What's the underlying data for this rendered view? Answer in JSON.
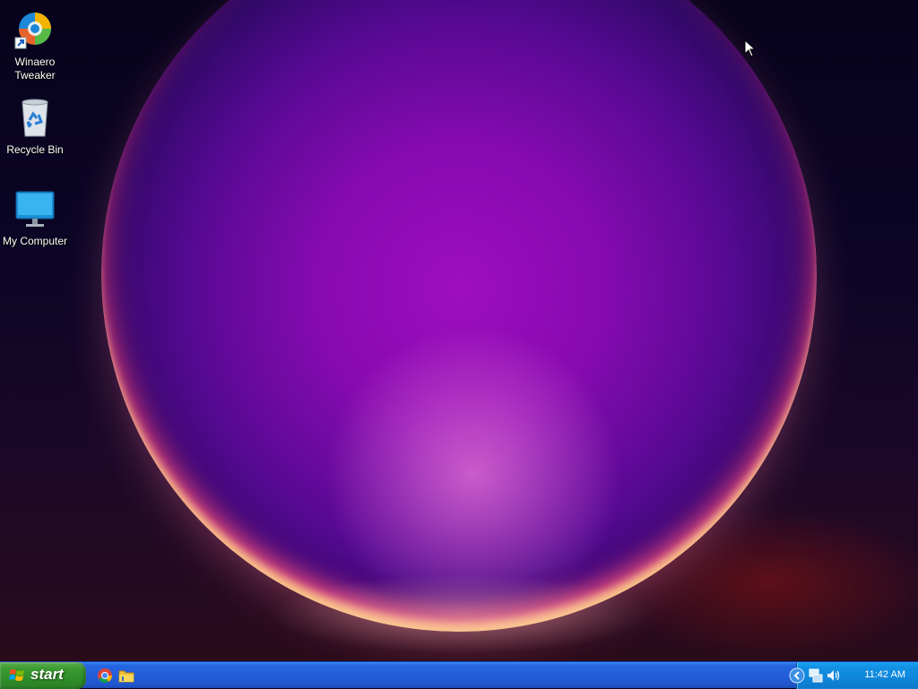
{
  "desktop": {
    "icons": [
      {
        "label": "Winaero Tweaker",
        "icon": "winaero-tweaker-icon"
      },
      {
        "label": "Recycle Bin",
        "icon": "recycle-bin-icon"
      },
      {
        "label": "My Computer",
        "icon": "my-computer-icon"
      }
    ]
  },
  "taskbar": {
    "start_label": "start",
    "quick_launch": [
      {
        "icon": "chrome-icon"
      },
      {
        "icon": "folder-icon"
      }
    ],
    "tray": {
      "icons": [
        "show-hidden-icons-chevron",
        "network-icon",
        "volume-icon"
      ],
      "clock": "11:42 AM"
    }
  },
  "colors": {
    "taskbar": "#245edc",
    "start_button": "#3c9a32",
    "tray": "#0f86da"
  }
}
